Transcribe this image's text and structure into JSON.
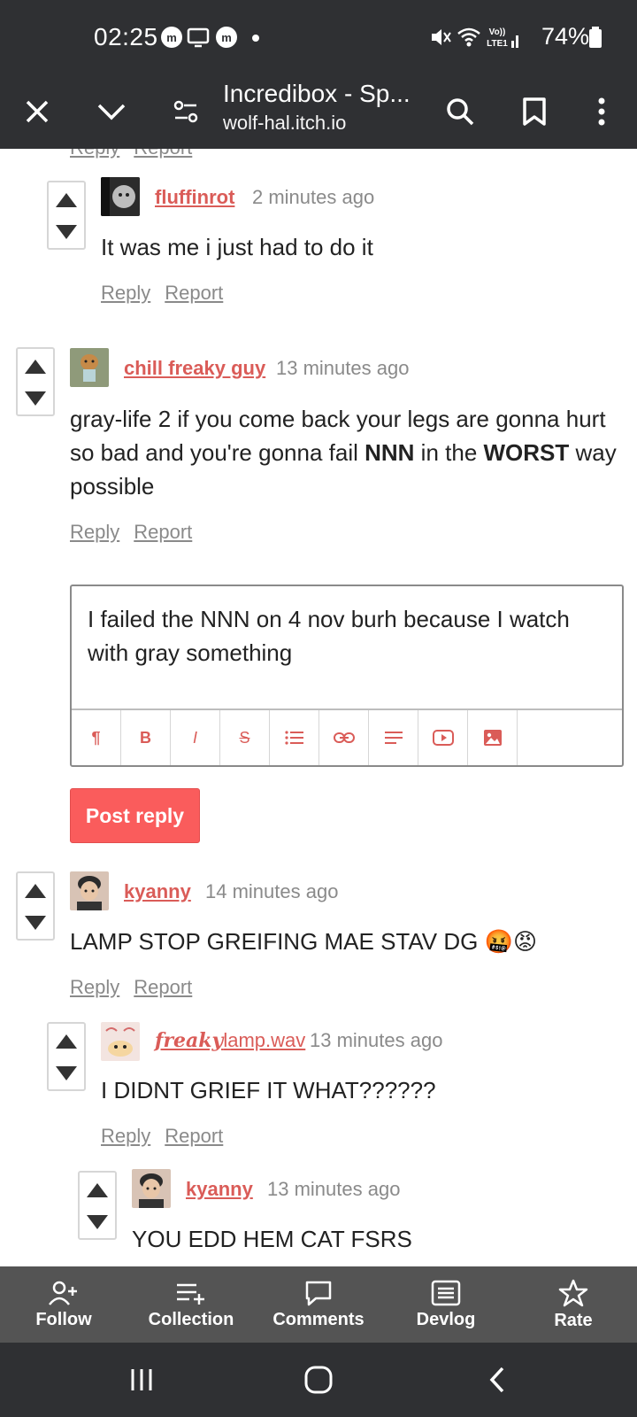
{
  "status_bar": {
    "time": "02:25",
    "battery": "74%"
  },
  "toolbar": {
    "title": "Incredibox - Sp...",
    "url": "wolf-hal.itch.io"
  },
  "top_cut": {
    "reply": "Reply",
    "report": "Report"
  },
  "comments": [
    {
      "author": "fluffinrot",
      "time": "2 minutes ago",
      "body": "It was me i just had to do it",
      "reply": "Reply",
      "report": "Report"
    },
    {
      "author": "chill freaky guy",
      "time": "13 minutes ago",
      "body_a": "gray-life 2 if you come back your legs are gonna hurt so bad and you're gonna fail ",
      "body_b": "NNN",
      "body_c": " in the ",
      "body_d": "WORST",
      "body_e": " way possible",
      "reply": "Reply",
      "report": "Report"
    },
    {
      "author": "kyanny",
      "time": "14 minutes ago",
      "body": "LAMP STOP GREIFING MAE STAV DG 🤬😡",
      "reply": "Reply",
      "report": "Report"
    },
    {
      "author_prefix": "freaky",
      "author": "lamp.wav",
      "time": "13 minutes ago",
      "body": "I DIDNT GRIEF IT WHAT??????",
      "reply": "Reply",
      "report": "Report"
    },
    {
      "author": "kyanny",
      "time": "13 minutes ago",
      "body": "YOU EDD HEM CAT FSRS"
    }
  ],
  "reply_box": {
    "text": "I failed the NNN on 4 nov burh because I watch with gray something",
    "post_label": "Post reply"
  },
  "editor_tools": [
    "paragraph-icon",
    "bold-icon",
    "italic-icon",
    "strikethrough-icon",
    "list-icon",
    "link-icon",
    "align-icon",
    "youtube-icon",
    "image-icon"
  ],
  "game_bar": {
    "items": [
      {
        "label": "Follow",
        "icon": "follow-icon"
      },
      {
        "label": "Collection",
        "icon": "collection-icon"
      },
      {
        "label": "Comments",
        "icon": "comments-icon"
      },
      {
        "label": "Devlog",
        "icon": "devlog-icon"
      },
      {
        "label": "Rate",
        "icon": "star-icon"
      }
    ]
  },
  "colors": {
    "accent": "#da5c58",
    "post_button": "#fa5c5c",
    "bar_dark": "#2f3033",
    "game_bar": "#545454"
  }
}
